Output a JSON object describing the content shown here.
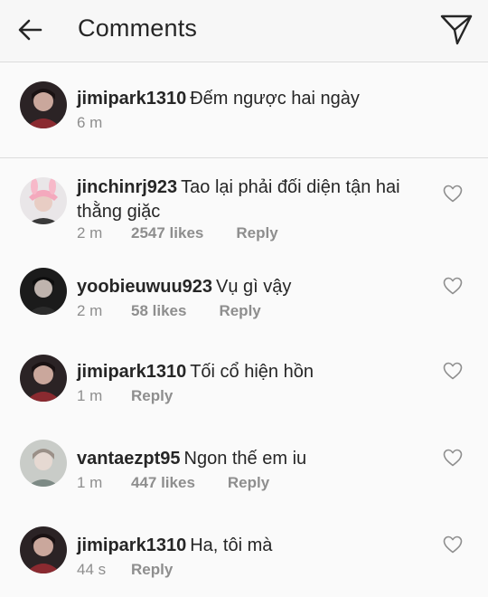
{
  "header": {
    "title": "Comments"
  },
  "caption": {
    "username": "jimipark1310",
    "text": "Đếm ngược hai ngày",
    "time": "6 m"
  },
  "comments": [
    {
      "username": "jinchinrj923",
      "text": "Tao lại phải đối diện tận hai thằng giặc",
      "time": "2 m",
      "likes": "2547 likes",
      "reply": "Reply",
      "avatar": "pink-bunny-hat"
    },
    {
      "username": "yoobieuwuu923",
      "text": "Vụ gì vậy",
      "time": "2 m",
      "likes": "58 likes",
      "reply": "Reply",
      "avatar": "dark-portrait"
    },
    {
      "username": "jimipark1310",
      "text": "Tối cổ hiện hồn",
      "time": "1 m",
      "likes": "",
      "reply": "Reply",
      "avatar": "red-portrait"
    },
    {
      "username": "vantaezpt95",
      "text": "Ngon thế em iu",
      "time": "1 m",
      "likes": "447 likes",
      "reply": "Reply",
      "avatar": "light-portrait"
    },
    {
      "username": "jimipark1310",
      "text": "Ha, tôi mà",
      "time": "44 s",
      "likes": "",
      "reply": "Reply",
      "avatar": "red-portrait"
    }
  ],
  "icons": {
    "back": "arrow-left-icon",
    "send": "paper-plane-icon",
    "like": "heart-outline-icon"
  }
}
